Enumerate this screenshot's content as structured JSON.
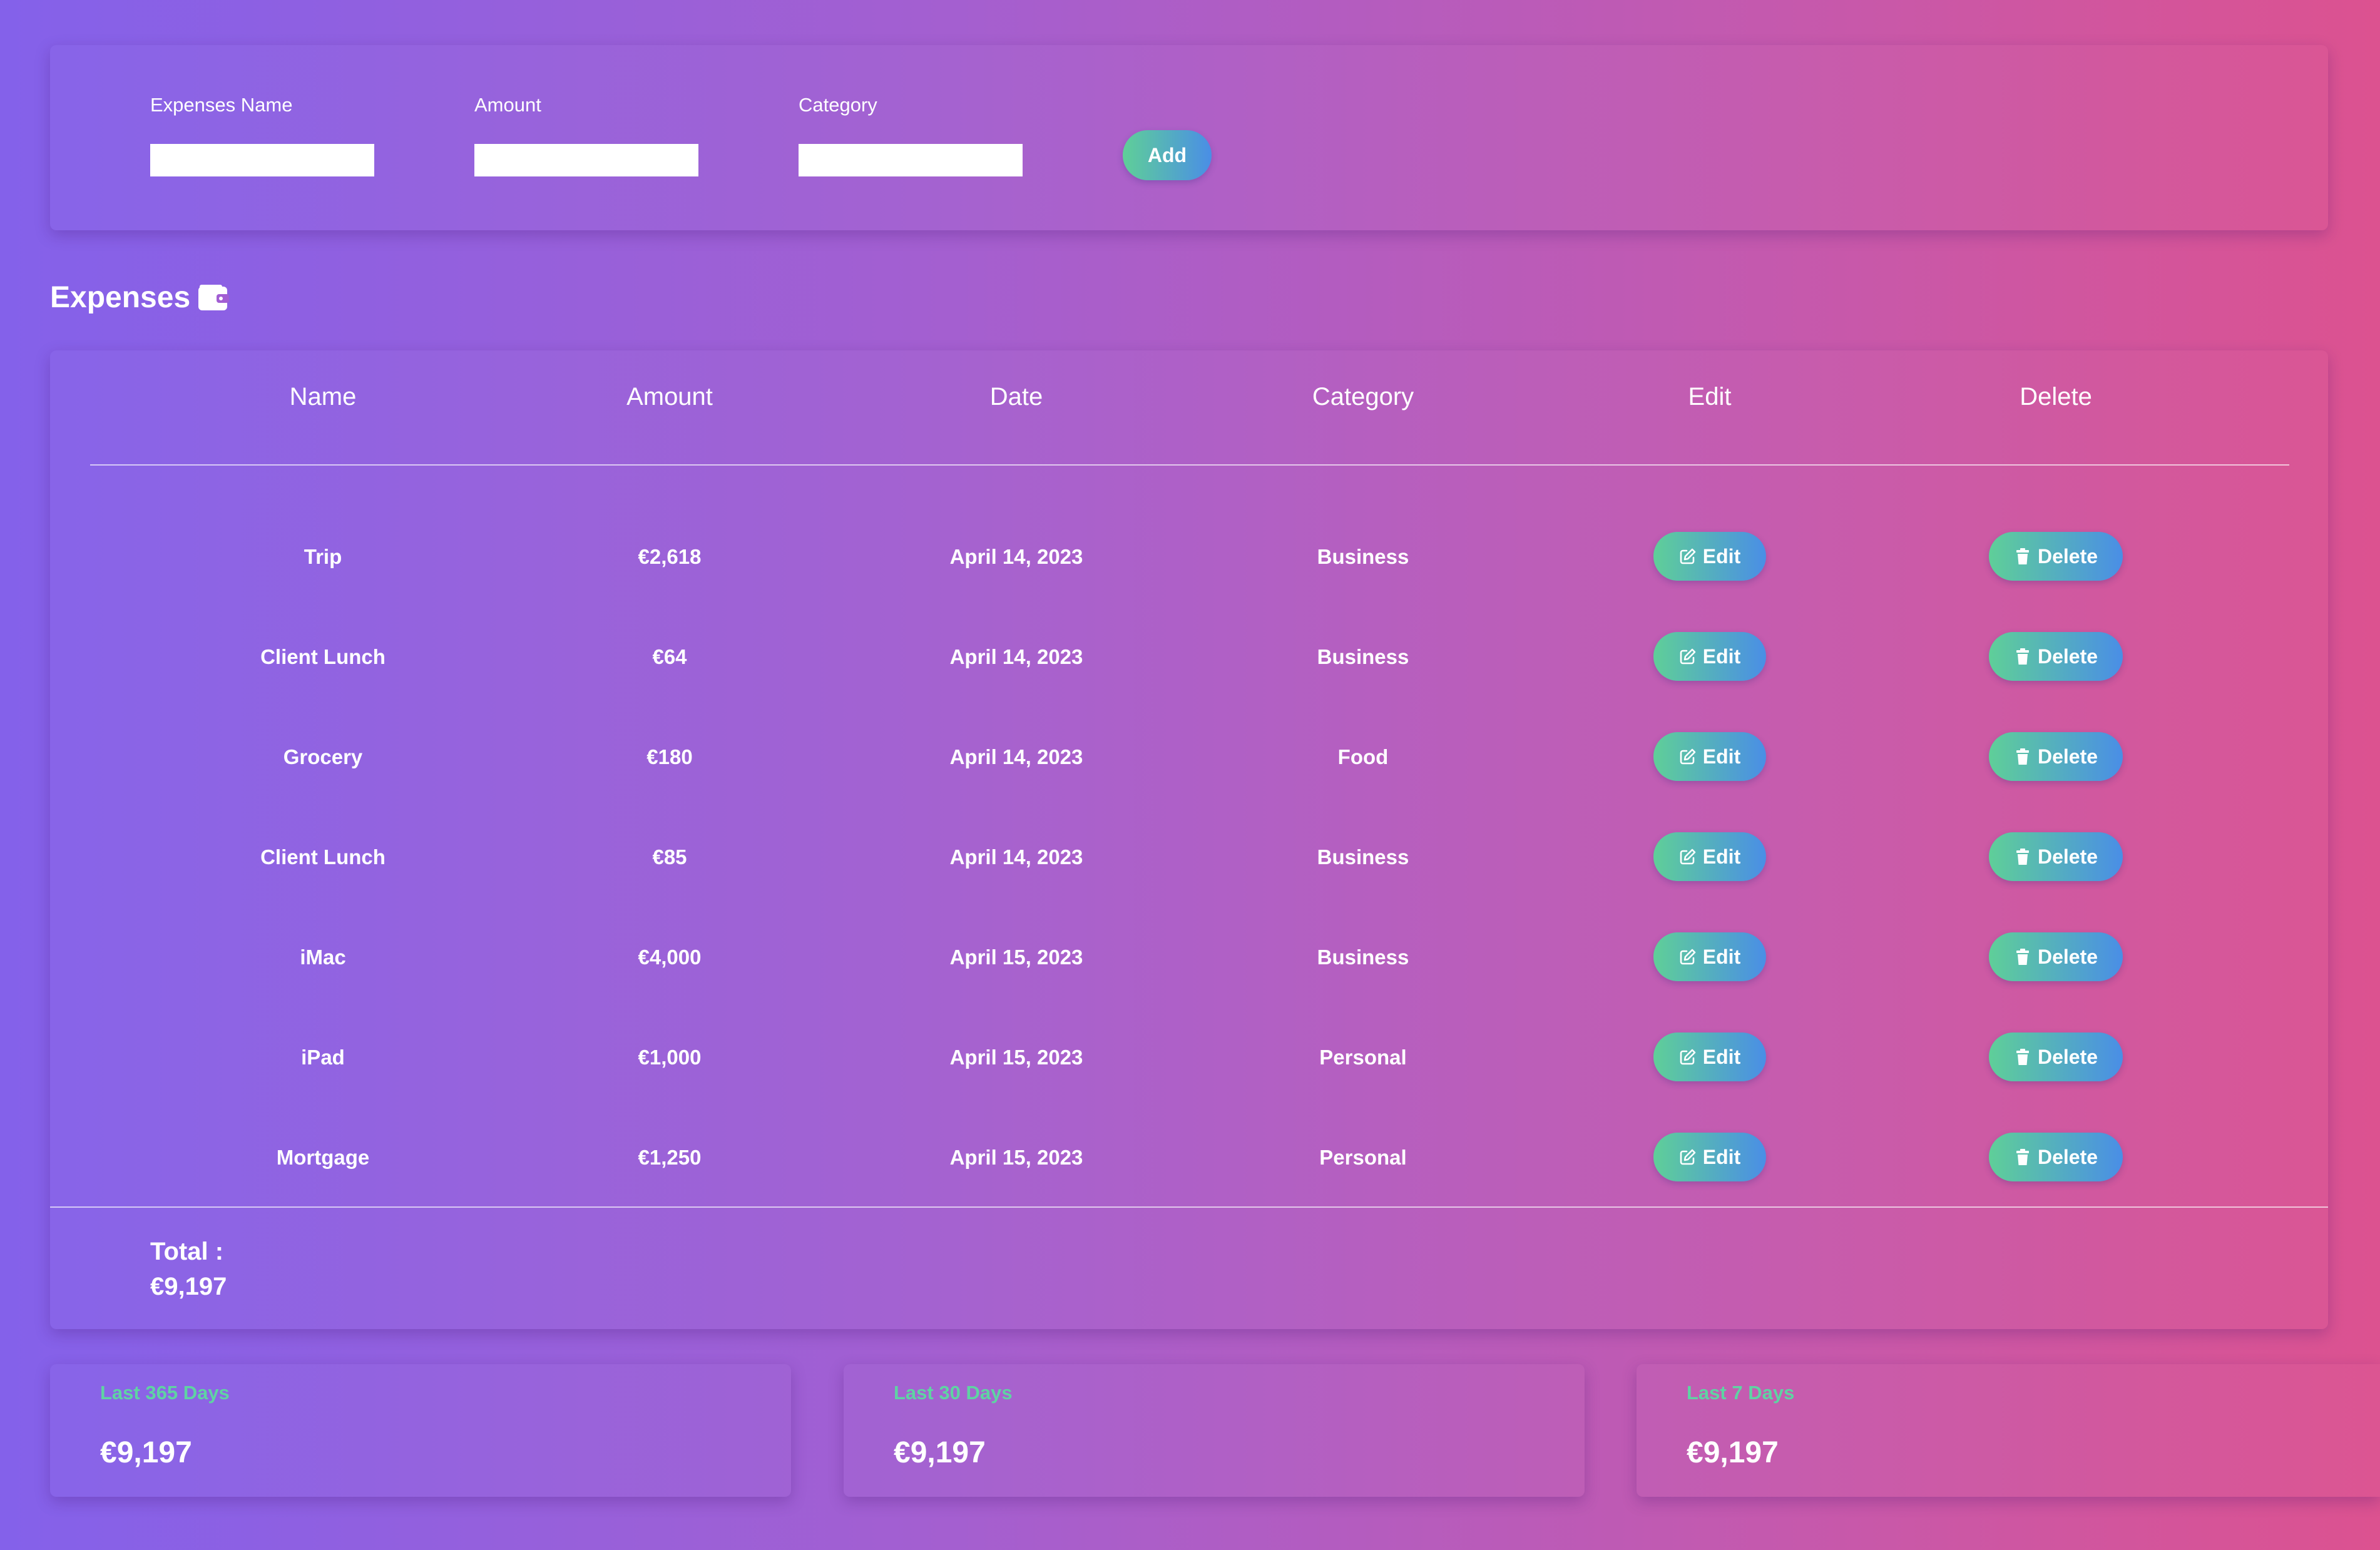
{
  "form": {
    "name_label": "Expenses Name",
    "name_value": "",
    "amount_label": "Amount",
    "amount_value": "",
    "category_label": "Category",
    "category_value": "",
    "add_label": "Add"
  },
  "expenses": {
    "title": "Expenses",
    "icon": "wallet-icon",
    "columns": [
      "Name",
      "Amount",
      "Date",
      "Category",
      "Edit",
      "Delete"
    ],
    "rows": [
      {
        "name": "Trip",
        "amount": "€2,618",
        "date": "April 14, 2023",
        "category": "Business"
      },
      {
        "name": "Client Lunch",
        "amount": "€64",
        "date": "April 14, 2023",
        "category": "Business"
      },
      {
        "name": "Grocery",
        "amount": "€180",
        "date": "April 14, 2023",
        "category": "Food"
      },
      {
        "name": "Client Lunch",
        "amount": "€85",
        "date": "April 14, 2023",
        "category": "Business"
      },
      {
        "name": "iMac",
        "amount": "€4,000",
        "date": "April 15, 2023",
        "category": "Business"
      },
      {
        "name": "iPad",
        "amount": "€1,000",
        "date": "April 15, 2023",
        "category": "Personal"
      },
      {
        "name": "Mortgage",
        "amount": "€1,250",
        "date": "April 15, 2023",
        "category": "Personal"
      }
    ],
    "edit_label": "Edit",
    "delete_label": "Delete",
    "edit_icon": "edit-icon",
    "delete_icon": "trash-icon"
  },
  "total": {
    "label": "Total :",
    "value": "€9,197"
  },
  "summary": [
    {
      "label": "Last 365 Days",
      "value": "€9,197"
    },
    {
      "label": "Last 30 Days",
      "value": "€9,197"
    },
    {
      "label": "Last 7 Days",
      "value": "€9,197"
    }
  ],
  "colors": {
    "background_start": "#8461ea",
    "background_end": "#dc5290",
    "button_gradient_start": "#5fcf98",
    "button_gradient_end": "#4a8ee6",
    "summary_label": "#5fd3a3"
  }
}
